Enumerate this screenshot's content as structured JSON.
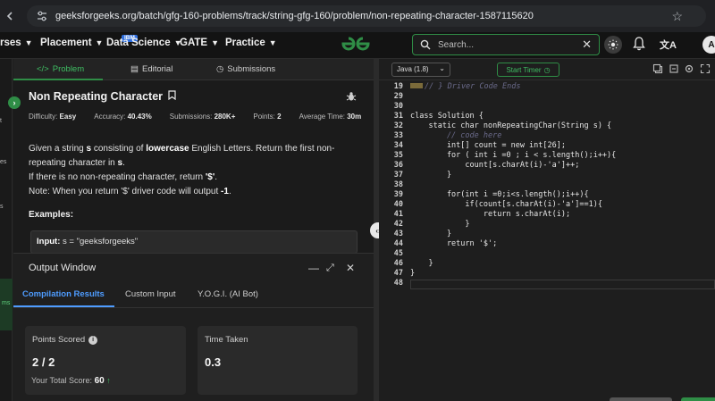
{
  "browser": {
    "url": "geeksforgeeks.org/batch/gfg-160-problems/track/string-gfg-160/problem/non-repeating-character-1587115620"
  },
  "site_nav": {
    "items": [
      {
        "label": "rses"
      },
      {
        "label": "Placement"
      },
      {
        "label": "Data Science"
      },
      {
        "label": "GATE"
      },
      {
        "label": "Practice"
      }
    ],
    "ibm_badge": "IBM",
    "search_placeholder": "Search...",
    "avatar_letter": "A",
    "accent": "#2f8d46"
  },
  "left_rail": {
    "labels": [
      "t",
      "es",
      "s",
      "ms"
    ]
  },
  "problem": {
    "tabs": [
      {
        "label": "Problem"
      },
      {
        "label": "Editorial"
      },
      {
        "label": "Submissions"
      }
    ],
    "title": "Non Repeating Character",
    "meta": {
      "difficulty_label": "Difficulty:",
      "difficulty": "Easy",
      "accuracy_label": "Accuracy:",
      "accuracy": "40.43%",
      "submissions_label": "Submissions:",
      "submissions": "280K+",
      "points_label": "Points:",
      "points": "2",
      "avg_time_label": "Average Time:",
      "avg_time": "30m"
    },
    "desc": {
      "l1a": "Given a string ",
      "l1b": "s",
      "l1c": " consisting of ",
      "l1d": "lowercase",
      "l1e": " English Letters. Return the first non-",
      "l2a": "repeating character in ",
      "l2b": "s",
      "l2c": ".",
      "l3a": "If there is no non-repeating character, return ",
      "l3b": "'$'",
      "l3c": ".",
      "l4a": "Note: When you return '$' driver code will output ",
      "l4b": "-1",
      "l4c": "."
    },
    "examples_label": "Examples:",
    "example_input_label": "Input:",
    "example_input_value": " s = \"geeksforgeeks\""
  },
  "output": {
    "title": "Output Window",
    "tabs": [
      {
        "label": "Compilation Results"
      },
      {
        "label": "Custom Input"
      },
      {
        "label": "Y.O.G.I. (AI Bot)"
      }
    ],
    "points_label": "Points Scored",
    "points_value": "2 / 2",
    "total_score_label": "Your Total Score:",
    "total_score": "60",
    "time_label": "Time Taken",
    "time_value": "0.3"
  },
  "editor": {
    "language": "Java (1.8)",
    "timer_label": "Start Timer",
    "lines": [
      {
        "n": "19",
        "code": "// } Driver Code Ends"
      },
      {
        "n": "29",
        "code": ""
      },
      {
        "n": "30",
        "code": ""
      },
      {
        "n": "31",
        "code": "class Solution {"
      },
      {
        "n": "32",
        "code": "    static char nonRepeatingChar(String s) {"
      },
      {
        "n": "33",
        "code": "        // code here"
      },
      {
        "n": "34",
        "code": "        int[] count = new int[26];"
      },
      {
        "n": "35",
        "code": "        for ( int i =0 ; i < s.length();i++){"
      },
      {
        "n": "36",
        "code": "            count[s.charAt(i)-'a']++;"
      },
      {
        "n": "37",
        "code": "        }"
      },
      {
        "n": "38",
        "code": ""
      },
      {
        "n": "39",
        "code": "        for(int i =0;i<s.length();i++){"
      },
      {
        "n": "40",
        "code": "            if(count[s.charAt(i)-'a']==1){"
      },
      {
        "n": "41",
        "code": "                return s.charAt(i);"
      },
      {
        "n": "42",
        "code": "            }"
      },
      {
        "n": "43",
        "code": "        }"
      },
      {
        "n": "44",
        "code": "        return '$';"
      },
      {
        "n": "45",
        "code": ""
      },
      {
        "n": "46",
        "code": "    }"
      },
      {
        "n": "47",
        "code": "}"
      },
      {
        "n": "48",
        "code": ""
      }
    ]
  }
}
